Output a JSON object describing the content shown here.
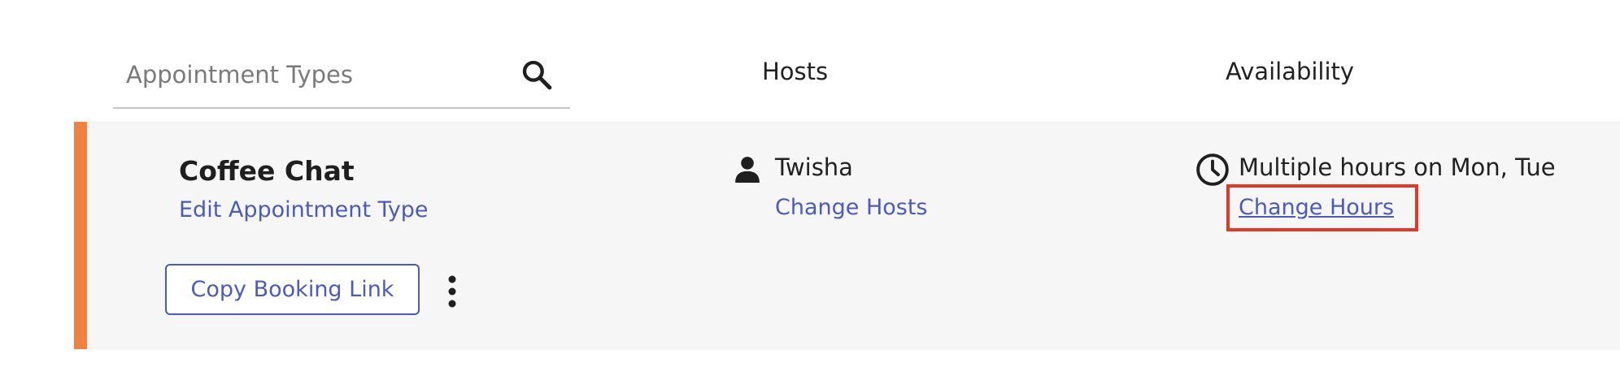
{
  "header": {
    "search_placeholder": "Appointment Types",
    "search_icon": "search-icon",
    "hosts_label": "Hosts",
    "availability_label": "Availability"
  },
  "appointment": {
    "title": "Coffee Chat",
    "edit_link": "Edit Appointment Type",
    "copy_button": "Copy Booking Link",
    "more_icon": "vertical-ellipsis-icon",
    "accent_color": "#ef8240",
    "host": {
      "icon": "person-icon",
      "name": "Twisha",
      "change_link": "Change Hosts"
    },
    "availability": {
      "icon": "clock-icon",
      "text": "Multiple hours on Mon, Tue",
      "change_link": "Change Hours",
      "highlight_color": "#e0392b"
    }
  },
  "colors": {
    "link": "#4c5bb8",
    "card_background": "#f6f6f6"
  }
}
